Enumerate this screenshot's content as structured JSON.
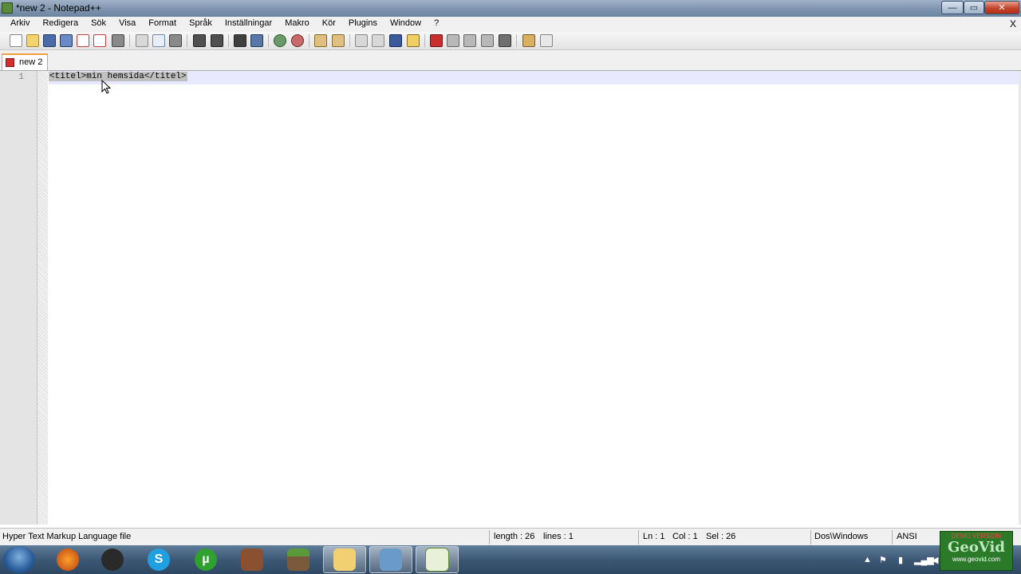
{
  "window": {
    "title": "*new  2 - Notepad++",
    "minimize_glyph": "—",
    "maximize_glyph": "▭",
    "close_glyph": "✕"
  },
  "menu": {
    "items": [
      "Arkiv",
      "Redigera",
      "Sök",
      "Visa",
      "Format",
      "Språk",
      "Inställningar",
      "Makro",
      "Kör",
      "Plugins",
      "Window",
      "?"
    ],
    "close_glyph": "X"
  },
  "tab": {
    "label": "new  2"
  },
  "editor": {
    "line_number": "1",
    "line1": "<titel>min hemsida</titel>"
  },
  "statusbar": {
    "file_type": "Hyper Text Markup Language file",
    "length": "length : 26",
    "lines": "lines : 1",
    "ln": "Ln : 1",
    "col": "Col : 1",
    "sel": "Sel : 26",
    "eol": "Dos\\Windows",
    "encoding": "ANSI"
  },
  "taskbar": {
    "apps": [
      "firefox-icon",
      "steam-icon",
      "skype-icon",
      "utorrent-icon",
      "game-icon",
      "minecraft-icon",
      "explorer-icon",
      "network-app-icon",
      "notepadpp-icon"
    ]
  },
  "watermark": {
    "line1": "DEMO VERSION",
    "line2": "GeoVid",
    "line3": "www.geovid.com"
  },
  "colors": {
    "selection": "#c0c0c0",
    "current_line": "#e8e8ff",
    "tab_accent": "#f0a040"
  }
}
